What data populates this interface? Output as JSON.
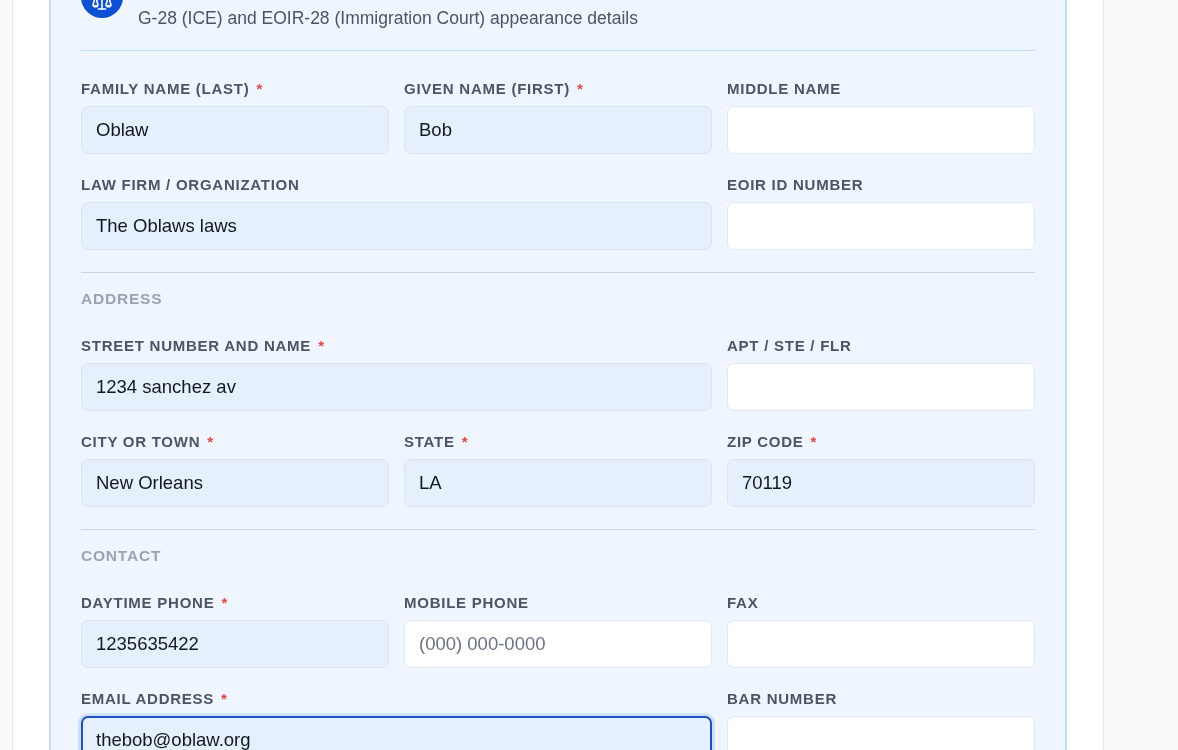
{
  "form_card": {
    "subtitle": "G-28 (ICE) and EOIR-28 (Immigration Court) appearance details",
    "sections": [
      {
        "rows": [
          [
            {
              "label": "FAMILY NAME (LAST)",
              "required_mark": "*",
              "value": "Oblaw",
              "focused": false
            },
            {
              "label": "GIVEN NAME (FIRST)",
              "required_mark": "*",
              "value": "Bob",
              "focused": false
            },
            {
              "label": "MIDDLE NAME",
              "focused": false
            }
          ],
          [
            {
              "label": "LAW FIRM / ORGANIZATION",
              "value": "The Oblaws laws",
              "focused": false
            },
            "",
            {
              "label": "EOIR ID NUMBER",
              "focused": false
            }
          ]
        ]
      },
      {
        "heading": "ADDRESS",
        "rows": [
          [
            {
              "label": "STREET NUMBER AND NAME",
              "required_mark": "*",
              "value": "1234 sanchez av",
              "focused": false
            },
            "",
            {
              "label": "APT / STE / FLR",
              "focused": false
            }
          ],
          [
            {
              "label": "CITY OR TOWN",
              "required_mark": "*",
              "value": "New Orleans",
              "focused": false
            },
            {
              "label": "STATE",
              "required_mark": "*",
              "value": "LA",
              "focused": false
            },
            {
              "label": "ZIP CODE",
              "required_mark": "*",
              "value": "70119",
              "focused": false
            }
          ]
        ]
      },
      {
        "heading": "CONTACT",
        "rows": [
          [
            {
              "label": "DAYTIME PHONE",
              "required_mark": "*",
              "value": "1235635422",
              "focused": false
            },
            {
              "label": "MOBILE PHONE",
              "placeholder": "(000) 000-0000",
              "focused": false
            },
            {
              "label": "FAX",
              "focused": false
            }
          ],
          [
            {
              "label": "EMAIL ADDRESS",
              "required_mark": "*",
              "value": "thebob@oblaw.org",
              "focused": true
            },
            "",
            {
              "label": "BAR NUMBER",
              "focused": false
            }
          ]
        ]
      }
    ]
  }
}
